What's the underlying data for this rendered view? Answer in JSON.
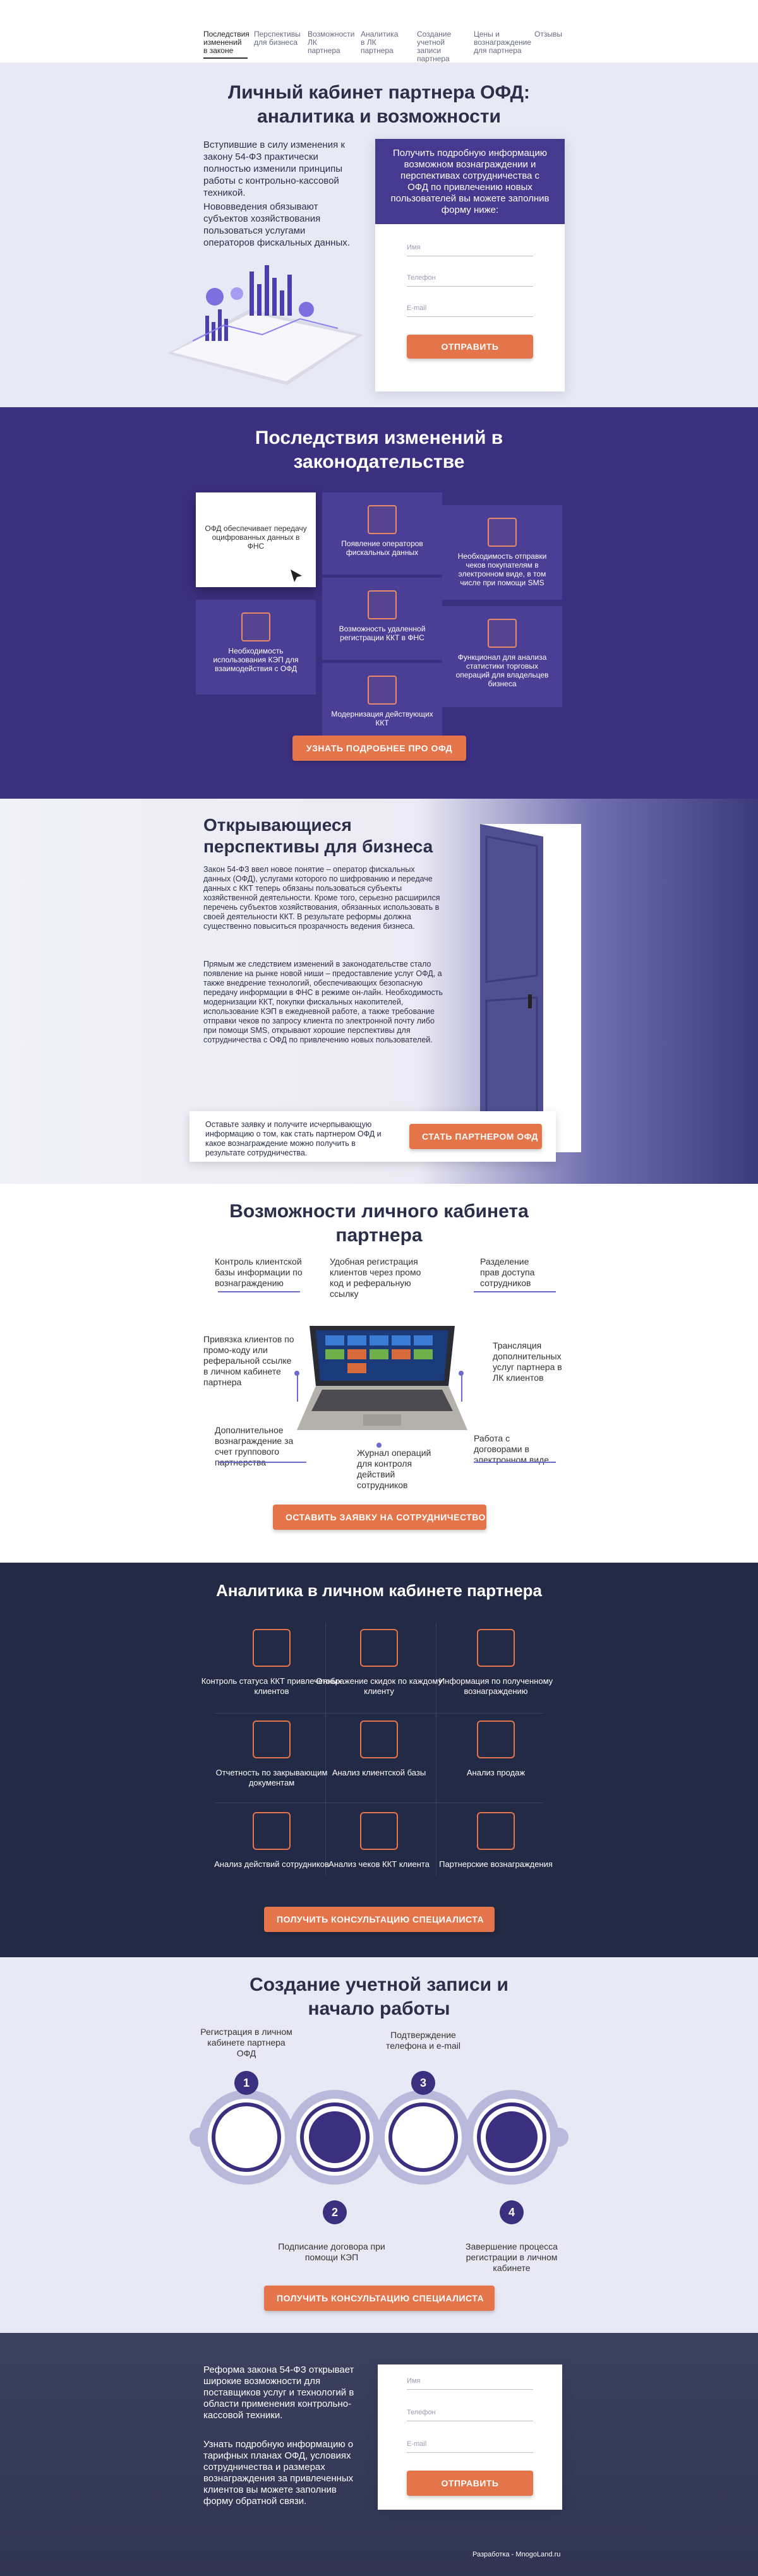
{
  "nav": {
    "items": [
      "Последствия изменений в законе",
      "Перспективы для бизнеса",
      "Возможности ЛК партнера",
      "Аналитика в ЛК партнера",
      "Создание учетной записи партнера",
      "Цены и вознаграждение для партнера",
      "Отзывы"
    ]
  },
  "hero": {
    "title": "Личный кабинет партнера ОФД: аналитика и возможности",
    "p1": "Вступившие в силу изменения к закону 54-ФЗ практически полностью изменили принципы работы с контрольно-кассовой техникой.",
    "p2": "Нововведения обязывают субъектов хозяйствования пользоваться услугами операторов фискальных данных.",
    "form_head": "Получить подробную информацию возможном вознаграждении и перспективах сотрудничества с ОФД по привлечению новых пользователей вы можете заполнив форму ниже:",
    "ph_name": "Имя",
    "ph_phone": "Телефон",
    "ph_email": "E-mail",
    "submit": "ОТПРАВИТЬ"
  },
  "cons": {
    "title": "Последствия изменений в законодательстве",
    "tiles": [
      "ОФД обеспечивает передачу оцифрованных данных в ФНС",
      "Появление операторов фискальных данных",
      "Необходимость отправки чеков покупателям в электронном виде, в том числе при помощи SMS",
      "Возможность удаленной регистрации ККТ в ФНС",
      "Необходимость использования КЭП для взаимодействия с ОФД",
      "Модернизация действующих ККТ",
      "Функционал для анализа статистики торговых операций для владельцев бизнеса"
    ],
    "button": "УЗНАТЬ ПОДРОБНЕЕ ПРО ОФД"
  },
  "open": {
    "title": "Открывающиеся перспективы для бизнеса",
    "p1": "Закон 54-ФЗ ввел новое понятие – оператор фискальных данных (ОФД), услугами которого по шифрованию и передаче данных с ККТ теперь обязаны пользоваться субъекты хозяйственной деятельности. Кроме того, серьезно расширился перечень субъектов хозяйствования, обязанных использовать в своей деятельности ККТ. В результате реформы должна существенно повыситься прозрачность ведения бизнеса.",
    "p2": "Прямым же следствием изменений в законодательстве стало появление на рынке новой ниши – предоставление услуг ОФД, а также внедрение технологий, обеспечивающих безопасную передачу информации в ФНС в режиме он-лайн. Необходимость модернизации ККТ, покупки фискальных накопителей, использование КЭП в ежедневной работе, а также требование отправки чеков по запросу клиента по электронной почту либо при помощи SMS, открывают хорошие перспективы для сотрудничества с ОФД по привлечению новых пользователей.",
    "cta_text": "Оставьте заявку и получите исчерпывающую информацию о том, как стать партнером ОФД и какое вознаграждение можно получить в результате сотрудничества.",
    "cta_button": "СТАТЬ ПАРТНЕРОМ ОФД"
  },
  "feat": {
    "title": "Возможности личного кабинета партнера",
    "labels": [
      "Контроль клиентской базы информации по вознаграждению",
      "Удобная регистрация клиентов через промо код и реферальную ссылку",
      "Разделение прав доступа сотрудников",
      "Привязка клиентов по промо-коду или реферальной ссылке в личном кабинете партнера",
      "Трансляция дополнительных услуг партнера в ЛК клиентов",
      "Дополнительное вознаграждение за счет группового партнерства",
      "Журнал операций для контроля действий сотрудников",
      "Работа с договорами в электронном виде"
    ],
    "button": "ОСТАВИТЬ ЗАЯВКУ НА СОТРУДНИЧЕСТВО"
  },
  "ana": {
    "title": "Аналитика в личном кабинете партнера",
    "cells": [
      "Контроль статуса ККТ привлеченных клиентов",
      "Отображение скидок по каждому клиенту",
      "Информация по полученному вознаграждению",
      "Отчетность по закрывающим документам",
      "Анализ клиентской базы",
      "Анализ продаж",
      "Анализ действий сотрудников",
      "Анализ чеков ККТ клиента",
      "Партнерские вознаграждения"
    ],
    "button": "ПОЛУЧИТЬ КОНСУЛЬТАЦИЮ СПЕЦИАЛИСТА"
  },
  "steps": {
    "title": "Создание учетной записи и начало работы",
    "labels": [
      "Регистрация в личном кабинете партнера ОФД",
      "Подписание договора при помощи КЭП",
      "Подтверждение телефона и e-mail",
      "Завершение процесса регистрации в личном кабинете"
    ],
    "numbers": [
      "1",
      "2",
      "3",
      "4"
    ],
    "button": "ПОЛУЧИТЬ КОНСУЛЬТАЦИЮ СПЕЦИАЛИСТА"
  },
  "foot": {
    "p1": "Реформа закона 54-ФЗ открывает широкие возможности для поставщиков услуг и технологий в области применения контрольно-кассовой техники.",
    "p2": "Узнать подробную информацию о тарифных планах ОФД, условиях сотрудничества и размерах вознаграждения за привлеченных клиентов вы можете заполнив форму обратной связи.",
    "ph_name": "Имя",
    "ph_phone": "Телефон",
    "ph_email": "E-mail",
    "submit": "ОТПРАВИТЬ",
    "credit": "Разработка - MnogoLand.ru"
  }
}
